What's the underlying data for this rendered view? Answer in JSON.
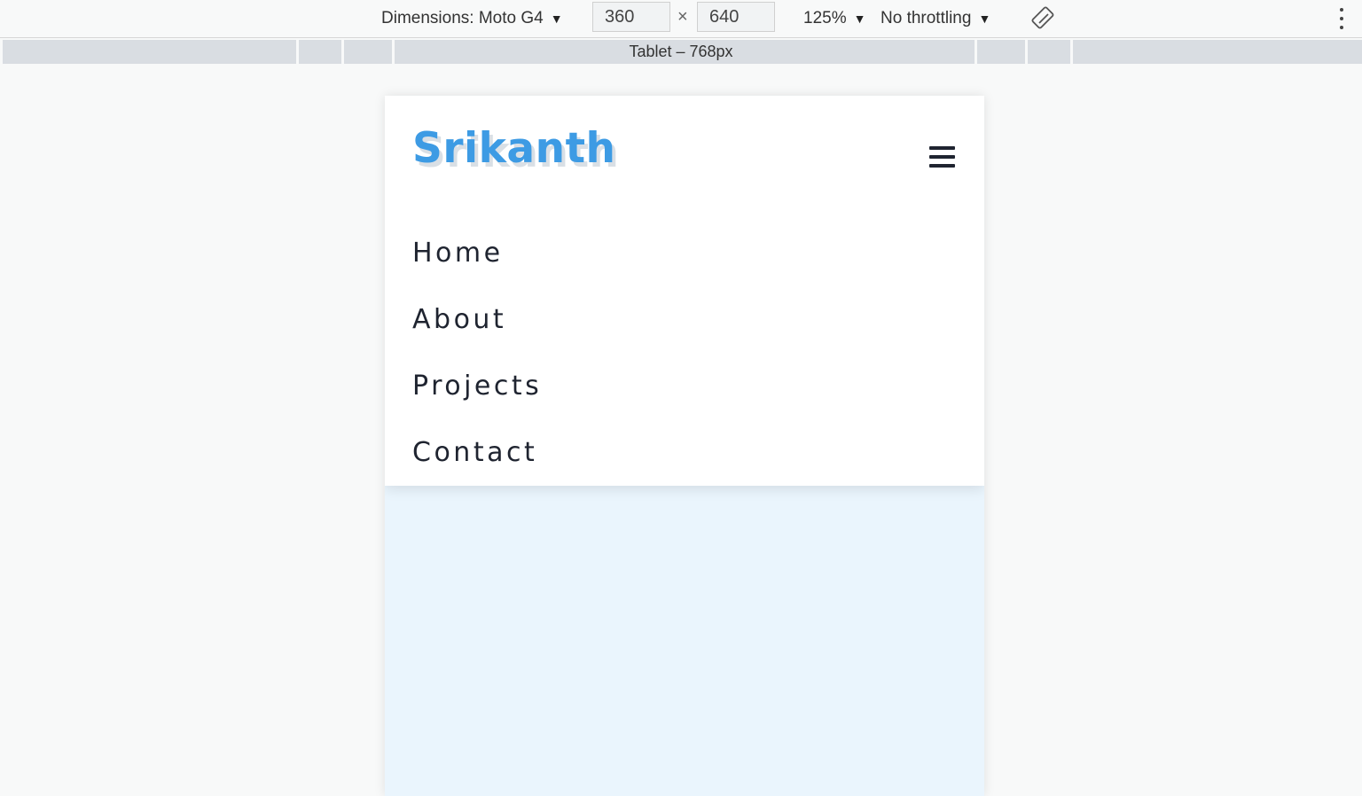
{
  "toolbar": {
    "dimensions_label": "Dimensions: Moto G4",
    "width_value": "360",
    "times_sign": "×",
    "height_value": "640",
    "zoom": "125%",
    "throttling": "No throttling"
  },
  "media_query_bar": {
    "label": "Tablet – 768px"
  },
  "site": {
    "brand": "Srikanth",
    "nav_links": [
      "Home",
      "About",
      "Projects",
      "Contact"
    ]
  },
  "colors": {
    "brand": "#3d9be4",
    "nav_text": "#1f2430",
    "content_bg": "#eaf5fd"
  },
  "icons": {
    "dropdown": "caret-down-icon",
    "rotate": "rotate-device-icon",
    "more": "more-options-icon",
    "menu": "hamburger-menu-icon"
  }
}
